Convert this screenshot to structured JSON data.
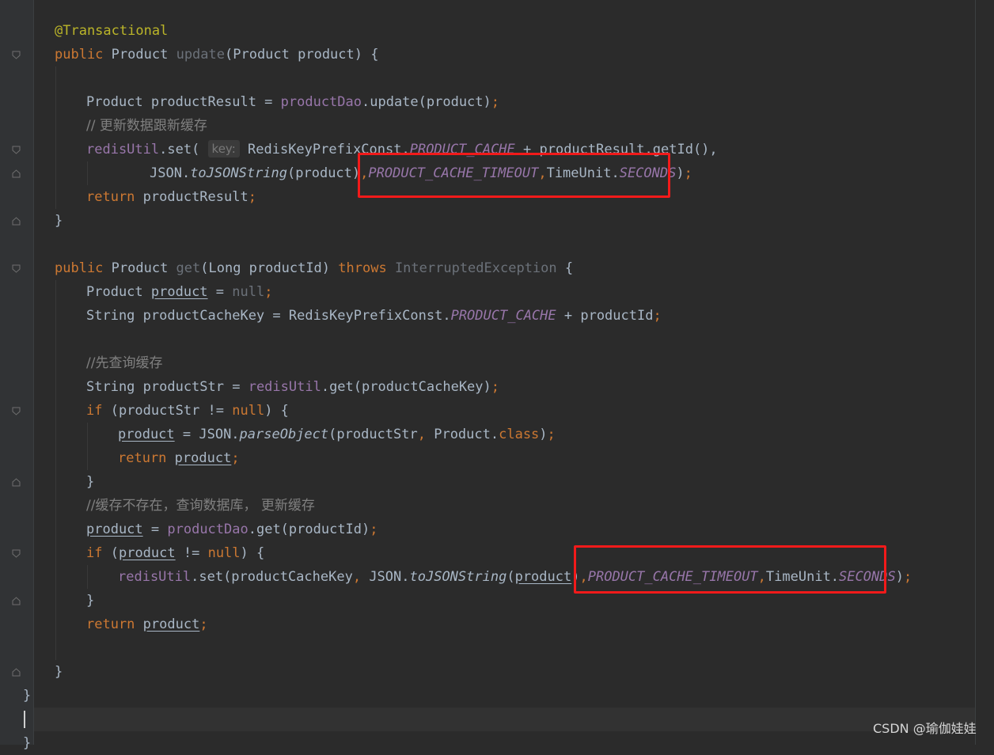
{
  "code": {
    "l1_annotation": "@Transactional",
    "l2_kw": "public",
    "l2_type": "Product",
    "l2_method": "update",
    "l2_params": "(Product product) {",
    "l4_decl": "Product productResult = ",
    "l4_field": "productDao",
    "l4_call": ".update(product)",
    "l5_comment": "// 更新数据跟新缓存",
    "l6_field": "redisUtil",
    "l6_call": ".set( ",
    "l6_hint": "key:",
    "l6_a": " RedisKeyPrefixConst.",
    "l6_const": "PRODUCT_CACHE",
    "l6_b": " + productResult.getId(),",
    "l7_a": "JSON.",
    "l7_method": "toJSONString",
    "l7_b": "(product)",
    "l7_const": "PRODUCT_CACHE_TIMEOUT",
    "l7_c": "TimeUnit.",
    "l7_const2": "SECONDS",
    "l7_d": ")",
    "l8_kw": "return",
    "l8_text": " productResult",
    "brace_close": "}",
    "l12_kw": "public",
    "l12_a": " Product ",
    "l12_method": "get",
    "l12_b": "(Long productId) ",
    "l12_kw2": "throws",
    "l12_exc": "InterruptedException",
    "l12_c": " {",
    "l13_a": "Product ",
    "l13_var": "product",
    "l13_b": " = ",
    "l13_null": "null",
    "l14_a": "String productCacheKey = RedisKeyPrefixConst.",
    "l14_const": "PRODUCT_CACHE",
    "l14_b": " + productId",
    "l16_comment": "//先查询缓存",
    "l17_a": "String productStr = ",
    "l17_field": "redisUtil",
    "l17_b": ".get(productCacheKey)",
    "l18_kw": "if",
    "l18_a": " (productStr != ",
    "l18_null": "null",
    "l18_b": ") {",
    "l19_var": "product",
    "l19_a": " = JSON.",
    "l19_method": "parseObject",
    "l19_b": "(productStr",
    "l19_comma": ",",
    "l19_c": " Product.",
    "l19_kw": "class",
    "l19_d": ")",
    "l20_kw": "return",
    "l20_var": "product",
    "l22_comment": "//缓存不存在，查询数据库， 更新缓存",
    "l23_var": "product",
    "l23_a": " = ",
    "l23_field": "productDao",
    "l23_b": ".get(productId)",
    "l24_kw": "if",
    "l24_a": " (",
    "l24_var": "product",
    "l24_b": " != ",
    "l24_null": "null",
    "l24_c": ") {",
    "l25_field": "redisUtil",
    "l25_a": ".set(productCacheKey",
    "l25_comma": ",",
    "l25_b": " JSON.",
    "l25_method": "toJSONString",
    "l25_c": "(",
    "l25_var": "product",
    "l25_d": ")",
    "l25_const": "PRODUCT_CACHE_TIMEOUT",
    "l25_e": "TimeUnit.",
    "l25_const2": "SECONDS",
    "l25_f": ")",
    "l27_kw": "return",
    "l27_var": "product",
    "semicolon": ";",
    "comma": ","
  },
  "watermark": "CSDN @瑜伽娃娃",
  "colors": {
    "background": "#2b2b2b",
    "keyword": "#cc7832",
    "annotation": "#bbb529",
    "method_decl": "#ffc66d",
    "field": "#9876aa",
    "comment": "#808080",
    "text": "#a9b7c6",
    "highlight_box": "#f21a1a"
  }
}
